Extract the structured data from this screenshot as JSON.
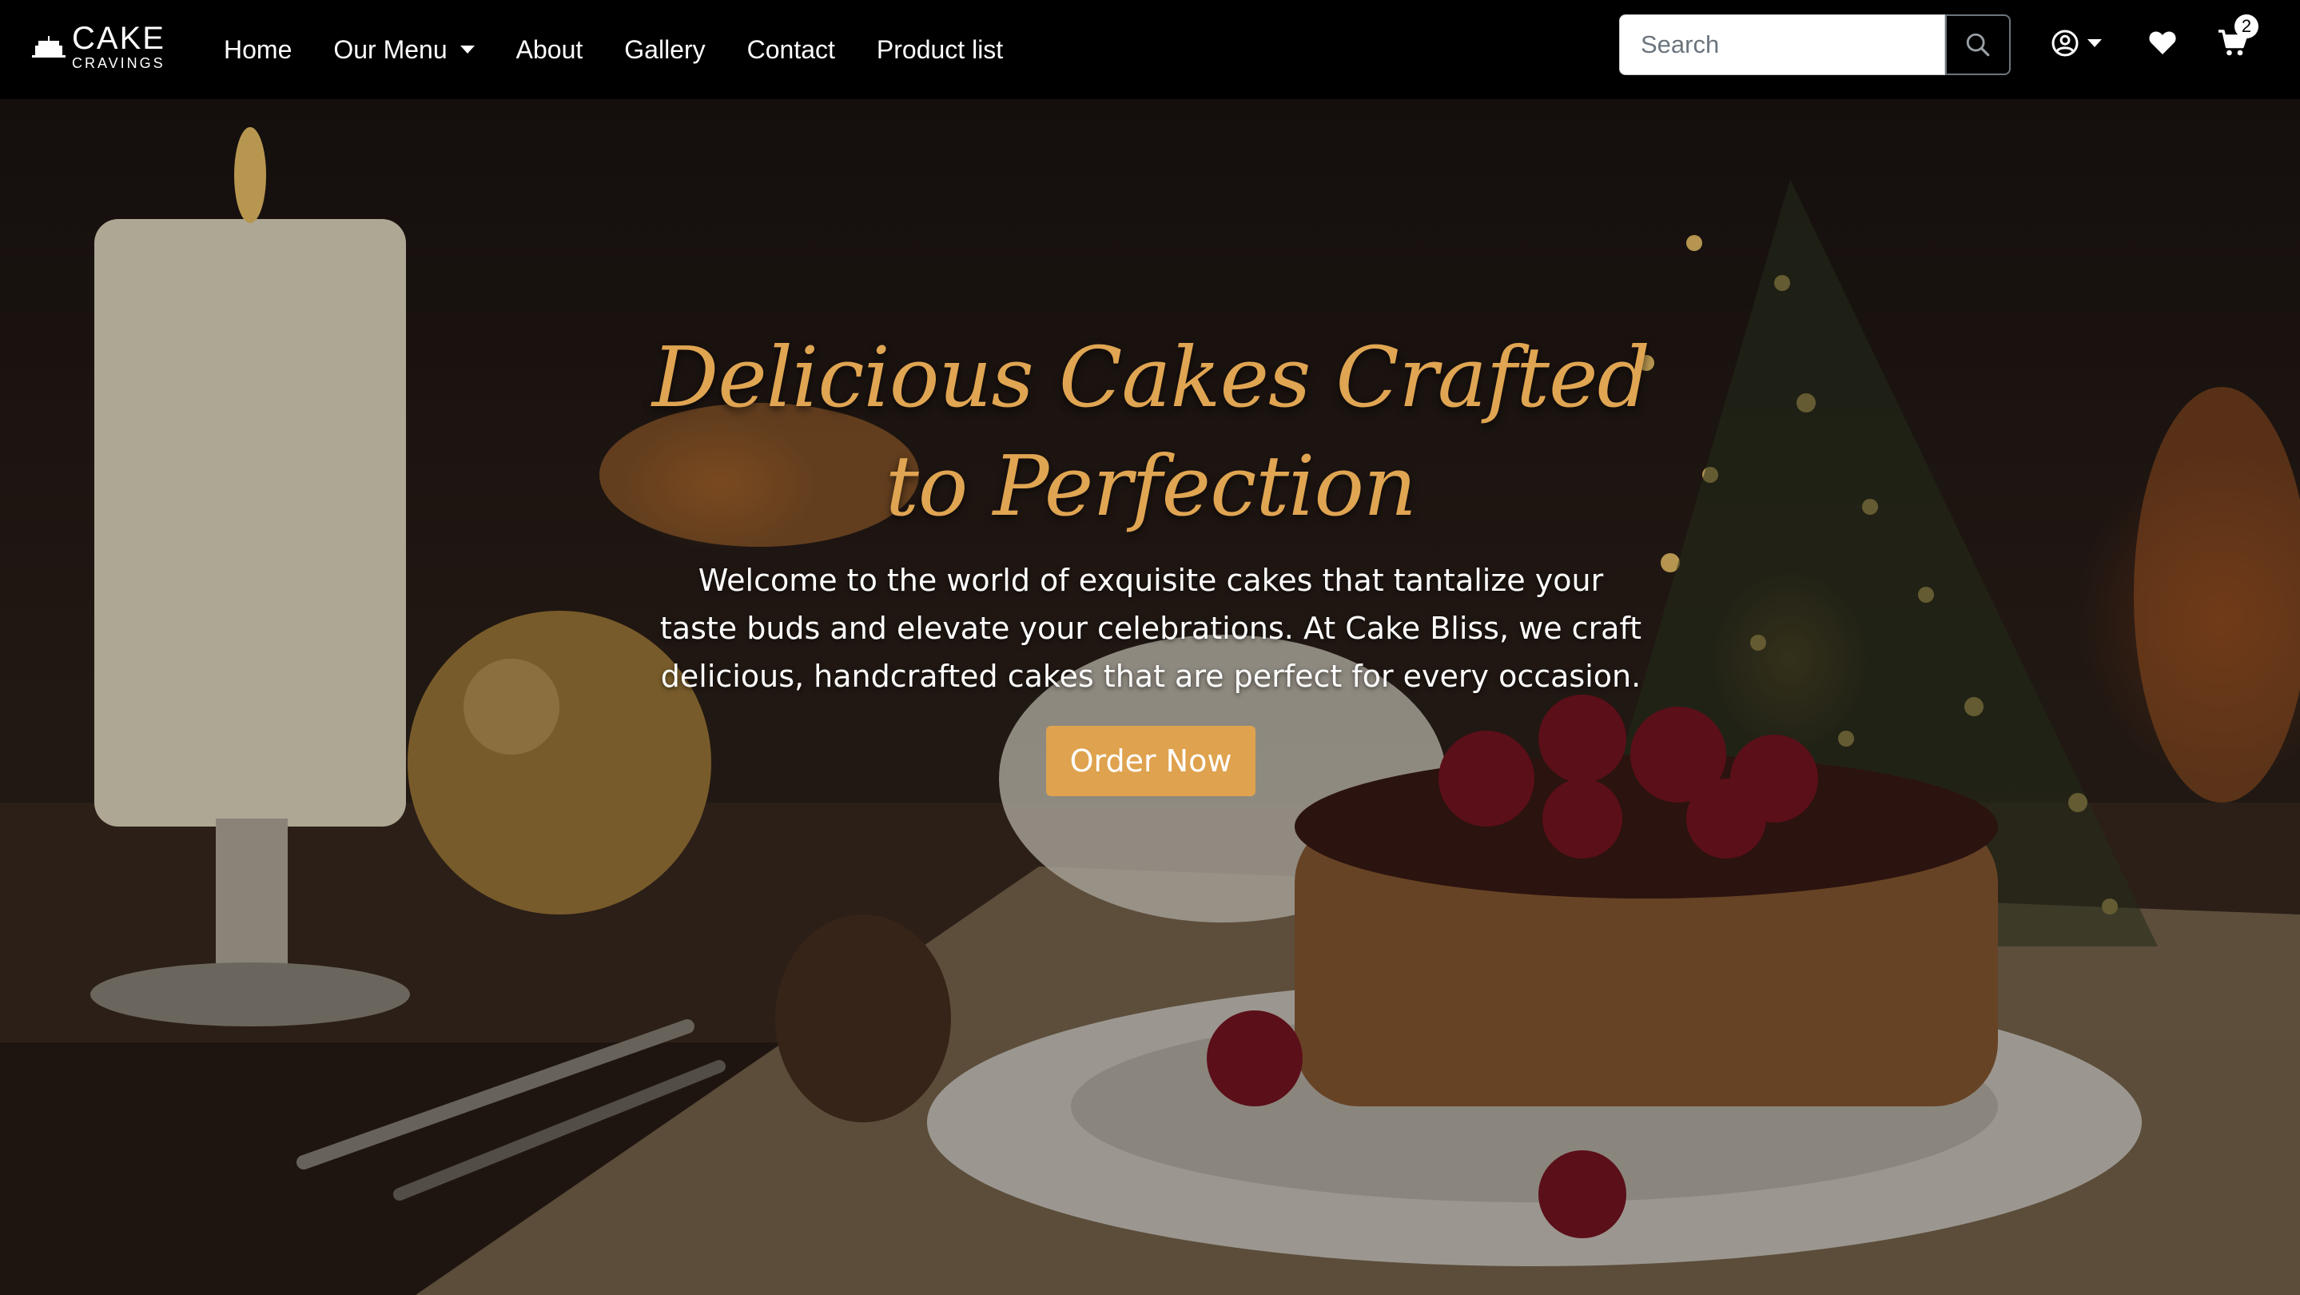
{
  "brand": {
    "name": "CAKE",
    "tagline": "CRAVINGS"
  },
  "nav": {
    "items": [
      {
        "label": "Home"
      },
      {
        "label": "Our Menu",
        "has_dropdown": true
      },
      {
        "label": "About"
      },
      {
        "label": "Gallery"
      },
      {
        "label": "Contact"
      },
      {
        "label": "Product list"
      }
    ]
  },
  "search": {
    "placeholder": "Search",
    "value": ""
  },
  "header_icons": {
    "account": "user-circle-icon",
    "wishlist": "heart-icon",
    "cart": "cart-icon",
    "cart_count": "2"
  },
  "hero": {
    "title": "Delicious Cakes Crafted to Perfection",
    "description": "Welcome to the world of exquisite cakes that tantalize your taste buds and elevate your celebrations. At Cake Bliss, we craft delicious, handcrafted cakes that are perfect for every occasion.",
    "cta_label": "Order Now"
  },
  "colors": {
    "accent": "#dfa24e",
    "title": "#e0a552",
    "navbar": "#000000"
  }
}
